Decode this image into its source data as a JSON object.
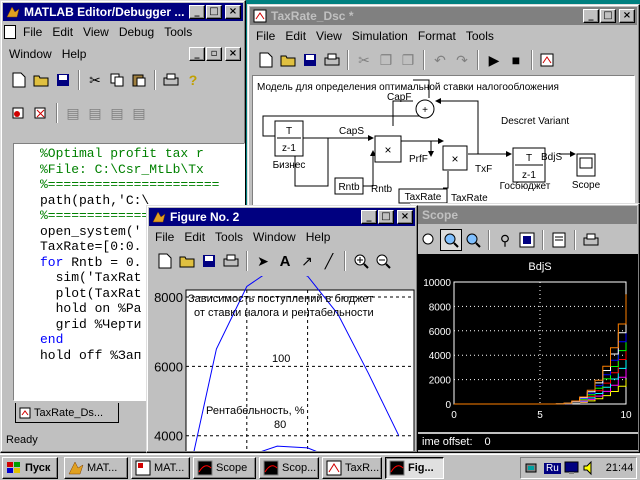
{
  "editor": {
    "title": "MATLAB Editor/Debugger ...",
    "menu": [
      "File",
      "Edit",
      "View",
      "Debug",
      "Tools"
    ],
    "menu2": [
      "Window",
      "Help"
    ],
    "code_lines": [
      {
        "cls": "cm",
        "text": "%Optimal profit tax r"
      },
      {
        "cls": "cm",
        "text": "%File: C:\\Csr_MtLb\\Tx"
      },
      {
        "cls": "cm",
        "text": "%======================"
      },
      {
        "cls": "",
        "text": "path(path,'C:\\"
      },
      {
        "cls": "cm",
        "text": "%======================"
      },
      {
        "cls": "",
        "text": "open_system('"
      },
      {
        "cls": "",
        "text": "TaxRate=[0:0."
      },
      {
        "cls": "kwline",
        "kw": "for",
        "text": " Rntb = 0."
      },
      {
        "cls": "",
        "text": "  sim('TaxRat"
      },
      {
        "cls": "",
        "text": "  plot(TaxRat"
      },
      {
        "cls": "",
        "text": "  hold on %Ра"
      },
      {
        "cls": "",
        "text": "  grid %Черти"
      },
      {
        "cls": "kwonly",
        "kw": "end",
        "text": ""
      },
      {
        "cls": "",
        "text": "hold off %Зап"
      }
    ],
    "tab_label": "TaxRate_Ds...",
    "status": "Ready"
  },
  "simulink": {
    "title": "TaxRate_Dsc *",
    "menu": [
      "File",
      "Edit",
      "View",
      "Simulation",
      "Format",
      "Tools"
    ],
    "model_title": "Модель для определения оптимальной ставки налогообложения",
    "blocks": {
      "biz_top": "T",
      "biz_bot": "z-1",
      "biz_label": "Бизнес",
      "caps": "CapS",
      "capf": "CapF",
      "descret": "Descret Variant",
      "rntb_block": "Rntb",
      "rntb_label": "Rntb",
      "prff": "PrfF",
      "txf": "TxF",
      "gov_top": "T",
      "gov_bot": "z-1",
      "gov_label": "Госбюджет",
      "bdjs": "BdjS",
      "scope_label": "Scope",
      "taxrate_block": "TaxRate",
      "taxrate_label": "TaxRate"
    }
  },
  "scope": {
    "title": "Scope",
    "plot_title": "BdjS",
    "y_ticks": [
      "10000",
      "8000",
      "6000",
      "4000",
      "2000",
      "0"
    ],
    "x_ticks": [
      "0",
      "5",
      "10"
    ],
    "footer": "ime offset:",
    "offset_value": "0"
  },
  "figure": {
    "title": "Figure No. 2",
    "menu": [
      "File",
      "Edit",
      "Tools",
      "Window",
      "Help"
    ],
    "y_ticks": [
      "8000",
      "6000",
      "4000"
    ],
    "annotation1": "Зависимость поступлений в бюджет",
    "annotation2": "от ставки налога и рентабельности",
    "label_100": "100",
    "label_rent": "Рентабельность, %",
    "label_80": "80"
  },
  "taskbar": {
    "start": "Пуск",
    "buttons": [
      "MAT...",
      "MAT...",
      "Scope",
      "Scop...",
      "TaxR...",
      "Fig..."
    ],
    "lang": "Ru",
    "clock": "21:44"
  },
  "colors": {
    "title_active": "#000080",
    "title_inactive": "#808080",
    "desktop": "#008080",
    "scope_bg": "#000000"
  },
  "chart_data": {
    "type": "line",
    "title": "",
    "xlabel": "",
    "ylabel": "",
    "annotations": [
      "Зависимость поступлений в бюджет",
      "от ставки налога и рентабельности",
      "100",
      "Рентабельность, %",
      "80"
    ],
    "ylim_visible": [
      3300,
      8200
    ],
    "series": [
      {
        "name": "100",
        "x": [
          0.0,
          0.1,
          0.2,
          0.3,
          0.4,
          0.5,
          0.6,
          0.7
        ],
        "values": [
          2500,
          6500,
          8300,
          8900,
          8600,
          7500,
          5800,
          4000
        ]
      },
      {
        "name": "80",
        "x": [
          0.1,
          0.2,
          0.3,
          0.4,
          0.5,
          0.6
        ],
        "values": [
          2500,
          3400,
          3700,
          3650,
          3300,
          2600
        ]
      }
    ],
    "grid": true
  }
}
